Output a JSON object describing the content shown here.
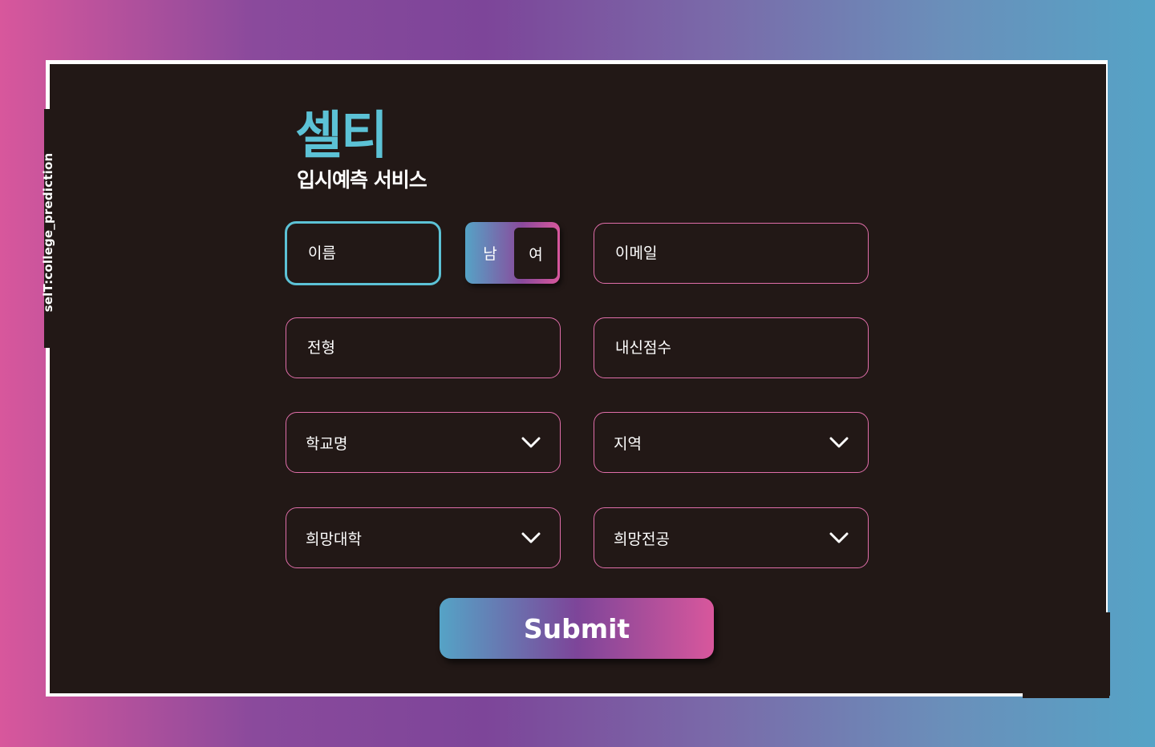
{
  "side_tag": "selT:college_prediction",
  "brand": {
    "title": "셀티",
    "subtitle": "입시예측 서비스"
  },
  "form": {
    "name_placeholder": "이름",
    "gender": {
      "male": "남",
      "female": "여",
      "selected": "여"
    },
    "email_placeholder": "이메일",
    "admission_type_placeholder": "전형",
    "gpa_placeholder": "내신점수",
    "school_select": "학교명",
    "region_select": "지역",
    "desired_university_select": "희망대학",
    "desired_major_select": "희망전공",
    "submit_label": "Submit"
  },
  "colors": {
    "accent_teal": "#5cc2d6",
    "accent_pink": "#e06ea9",
    "panel_bg": "#221816"
  },
  "icons": {
    "dropdown": "chevron-down-icon"
  }
}
